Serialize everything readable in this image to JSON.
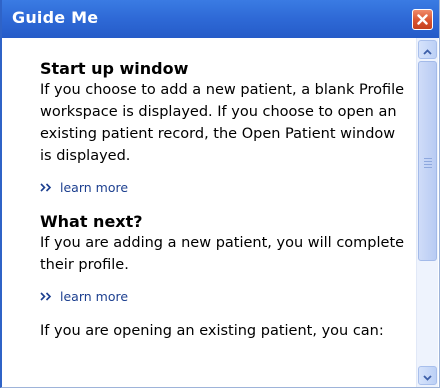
{
  "window": {
    "title": "Guide Me",
    "close_icon": "close-icon"
  },
  "sections": [
    {
      "heading": "Start up window",
      "body": "If you choose to add a new patient, a blank Profile workspace is displayed. If you choose to open an existing patient record, the Open Patient window is displayed.",
      "link": "learn more"
    },
    {
      "heading": "What next?",
      "body": "If you are adding a new patient, you will complete their profile.",
      "link": "learn more"
    },
    {
      "heading": "",
      "body": "If you are opening an existing patient, you can:",
      "link": ""
    }
  ],
  "icons": {
    "learn_more": "double-chevron-right-icon",
    "scroll_up": "chevron-up-icon",
    "scroll_down": "chevron-down-icon"
  },
  "colors": {
    "titlebar": "#2e69d6",
    "close_button": "#d9532f",
    "link": "#1c3f8f"
  }
}
